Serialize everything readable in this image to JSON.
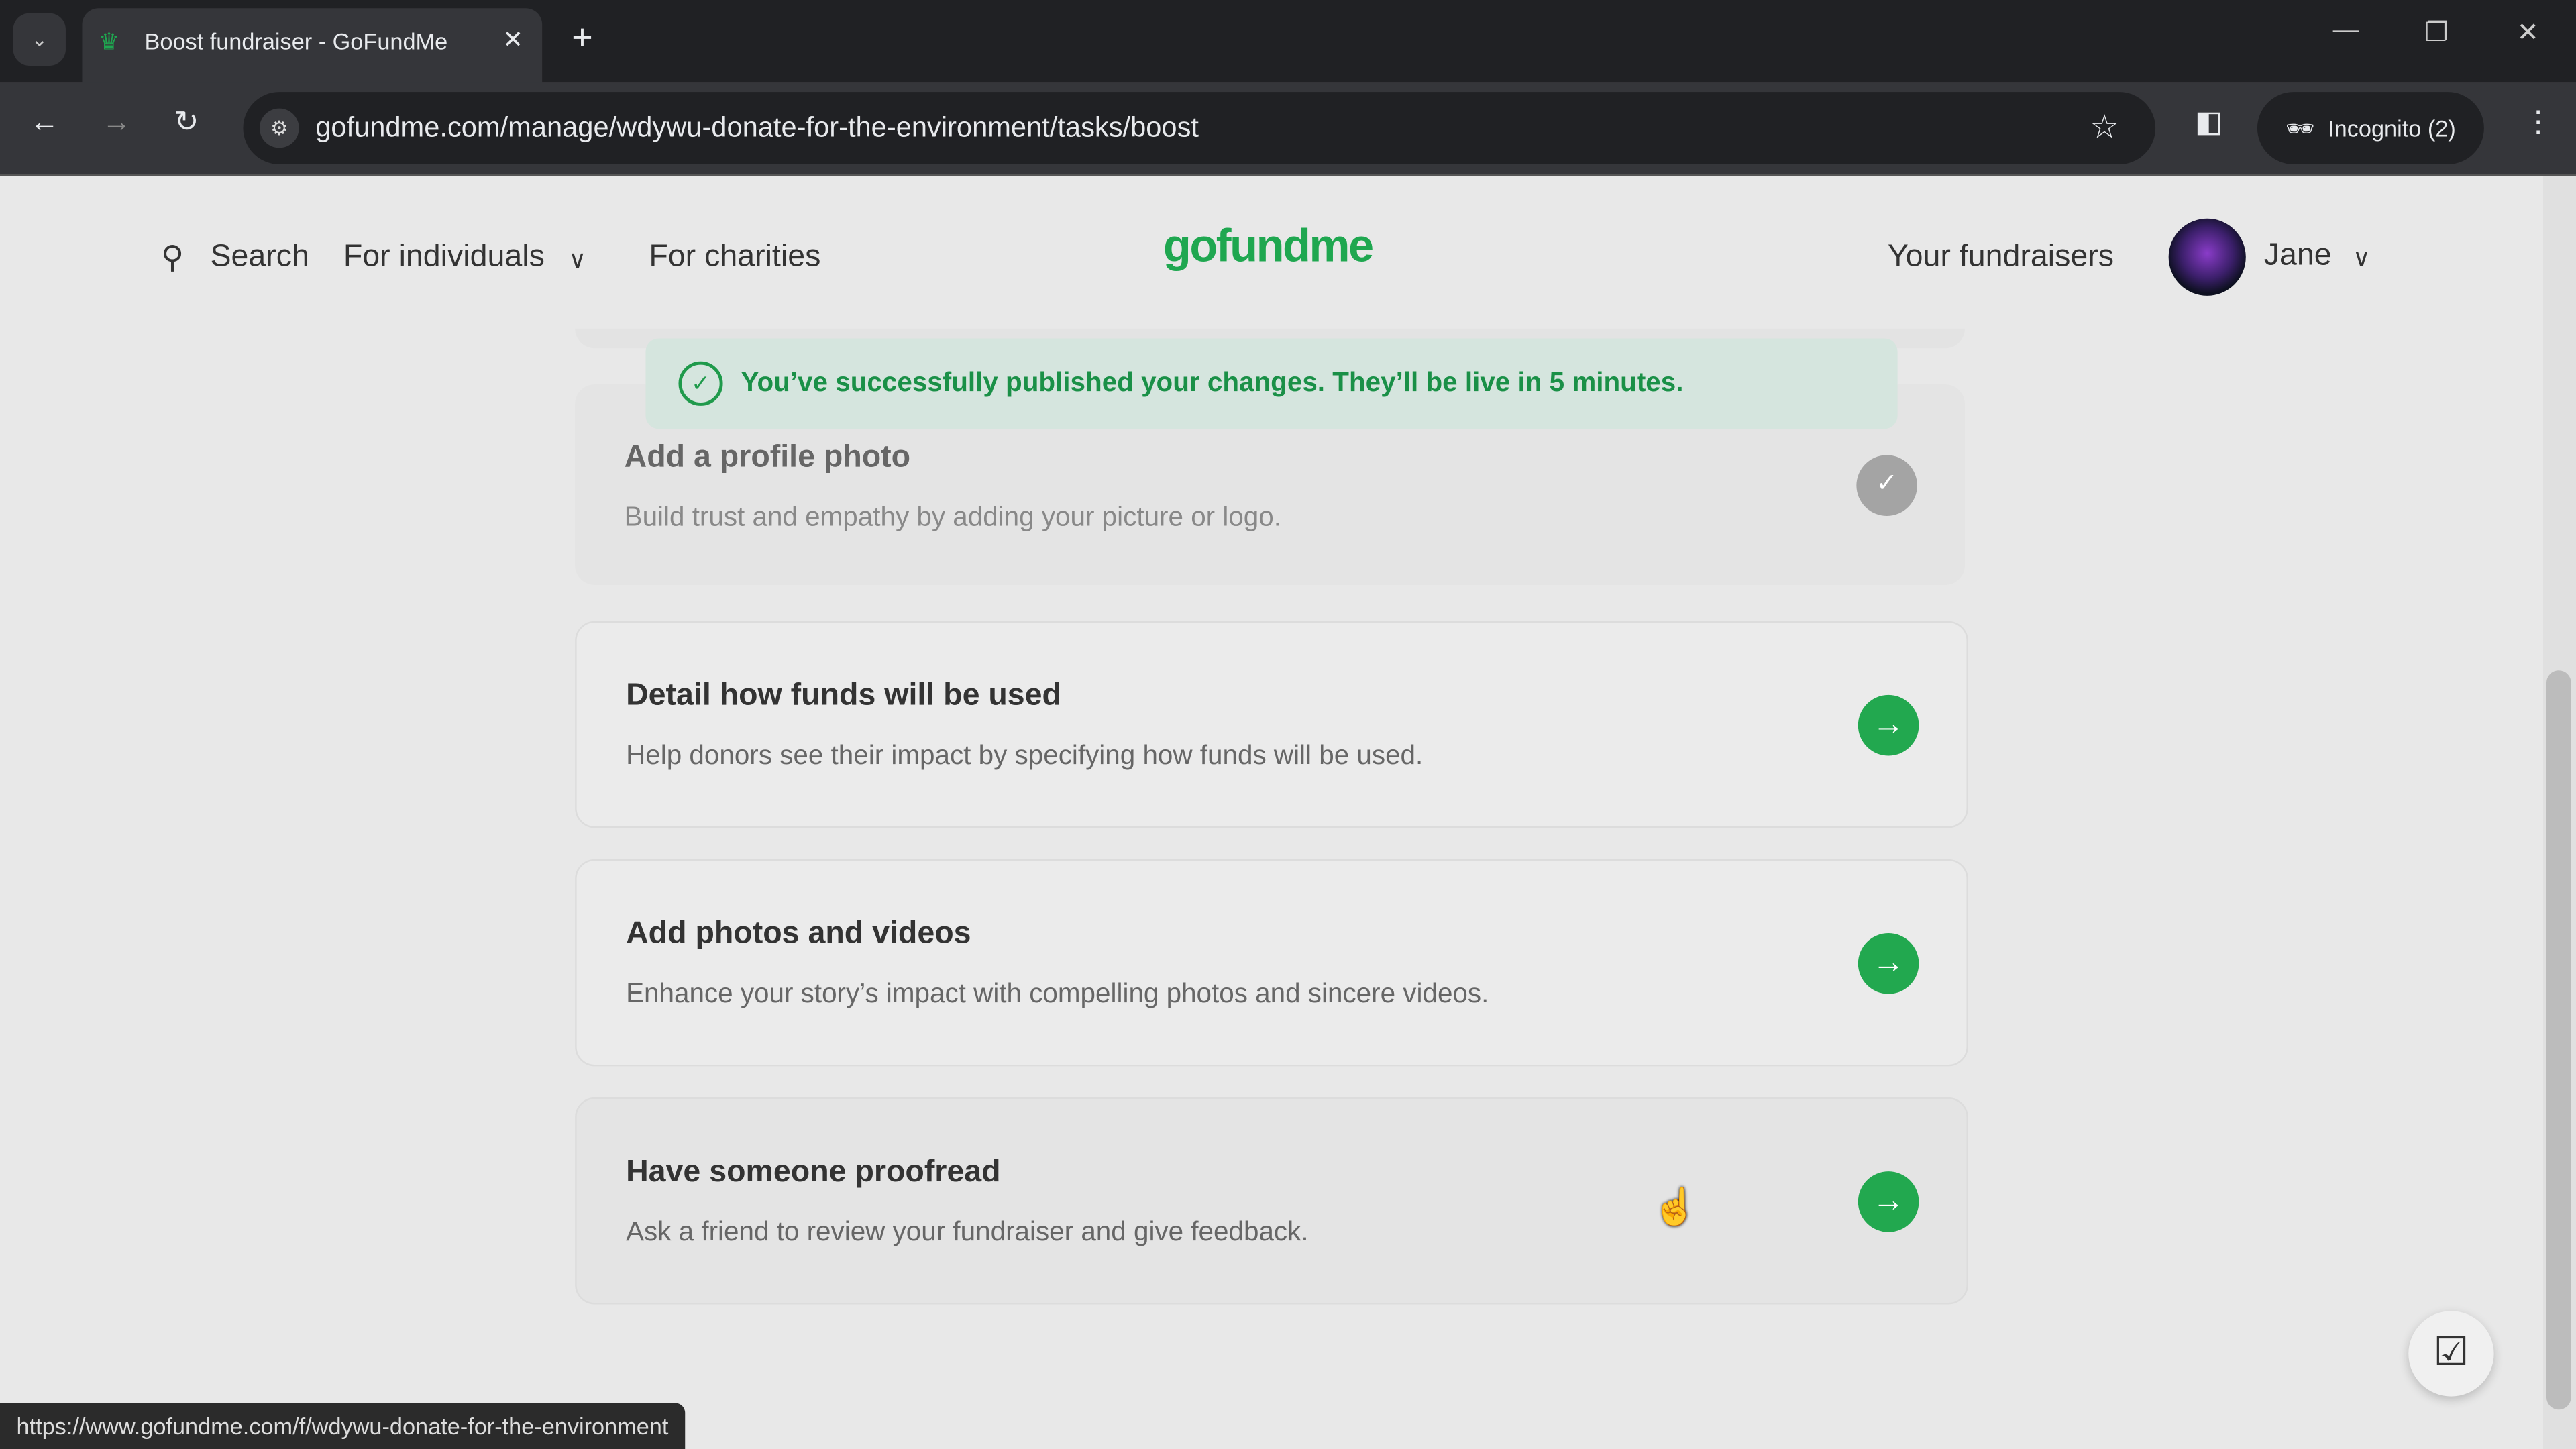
{
  "browser": {
    "tab_title": "Boost fundraiser - GoFundMe",
    "url": "gofundme.com/manage/wdywu-donate-for-the-environment/tasks/boost",
    "incognito": "Incognito (2)",
    "status_url": "https://www.gofundme.com/f/wdywu-donate-for-the-environment"
  },
  "header": {
    "search": "Search",
    "for_individuals": "For individuals",
    "for_charities": "For charities",
    "logo": "gofundme",
    "your_fundraisers": "Your fundraisers",
    "user": "Jane"
  },
  "toast": {
    "message": "You’ve successfully published your changes. They’ll be live in 5 minutes."
  },
  "tasks": [
    {
      "title": "Add a profile photo",
      "desc": "Build trust and empathy by adding your picture or logo.",
      "done": true
    },
    {
      "title": "Detail how funds will be used",
      "desc": "Help donors see their impact by specifying how funds will be used.",
      "done": false
    },
    {
      "title": "Add photos and videos",
      "desc": "Enhance your story’s impact with compelling photos and sincere videos.",
      "done": false
    },
    {
      "title": "Have someone proofread",
      "desc": "Ask a friend to review your fundraiser and give feedback.",
      "done": false
    }
  ],
  "colors": {
    "brand": "#22a84f",
    "toast_bg": "#d5e5de"
  }
}
